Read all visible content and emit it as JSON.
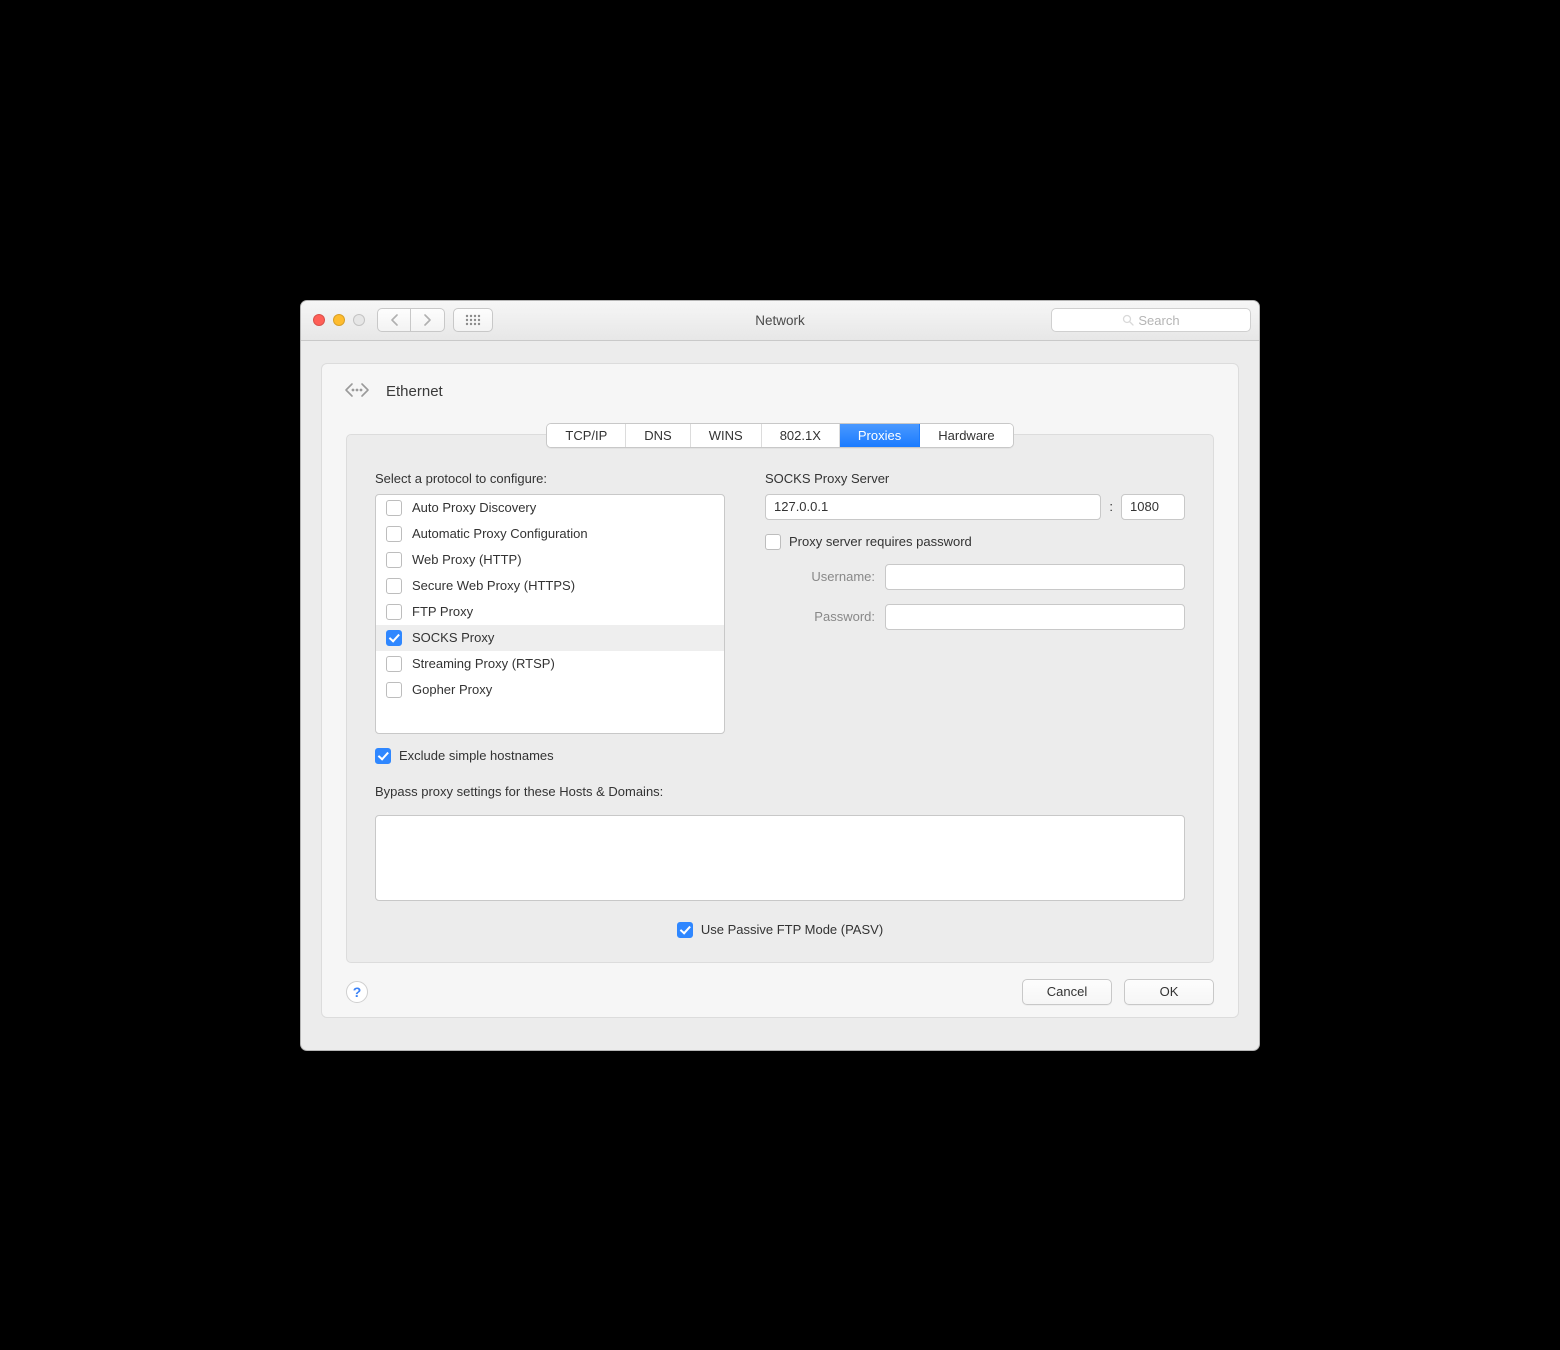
{
  "window": {
    "title": "Network"
  },
  "search": {
    "placeholder": "Search"
  },
  "interface": {
    "name": "Ethernet"
  },
  "tabs": [
    {
      "label": "TCP/IP"
    },
    {
      "label": "DNS"
    },
    {
      "label": "WINS"
    },
    {
      "label": "802.1X"
    },
    {
      "label": "Proxies",
      "active": true
    },
    {
      "label": "Hardware"
    }
  ],
  "protocols": {
    "select_label": "Select a protocol to configure:",
    "items": [
      {
        "label": "Auto Proxy Discovery",
        "checked": false
      },
      {
        "label": "Automatic Proxy Configuration",
        "checked": false
      },
      {
        "label": "Web Proxy (HTTP)",
        "checked": false
      },
      {
        "label": "Secure Web Proxy (HTTPS)",
        "checked": false
      },
      {
        "label": "FTP Proxy",
        "checked": false
      },
      {
        "label": "SOCKS Proxy",
        "checked": true,
        "selected": true
      },
      {
        "label": "Streaming Proxy (RTSP)",
        "checked": false
      },
      {
        "label": "Gopher Proxy",
        "checked": false
      }
    ]
  },
  "proxy": {
    "server_label": "SOCKS Proxy Server",
    "host": "127.0.0.1",
    "port": "1080",
    "requires_password_label": "Proxy server requires password",
    "requires_password": false,
    "username_label": "Username:",
    "username": "",
    "password_label": "Password:",
    "password": ""
  },
  "exclude_simple": {
    "label": "Exclude simple hostnames",
    "checked": true
  },
  "bypass": {
    "label": "Bypass proxy settings for these Hosts & Domains:",
    "value": ""
  },
  "pasv": {
    "label": "Use Passive FTP Mode (PASV)",
    "checked": true
  },
  "buttons": {
    "cancel": "Cancel",
    "ok": "OK"
  },
  "help": {
    "label": "?"
  }
}
